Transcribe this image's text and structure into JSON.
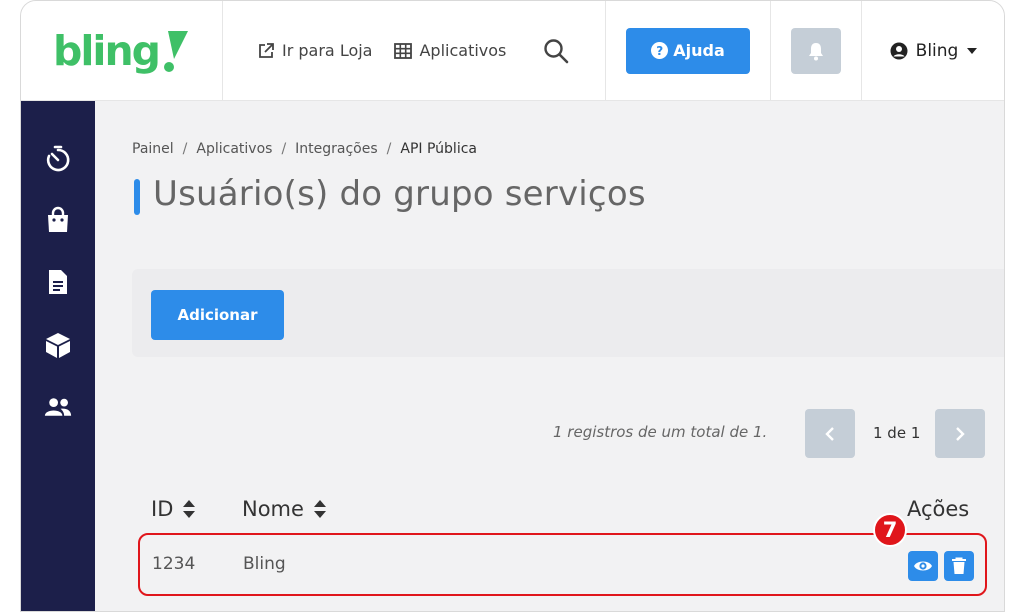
{
  "brand": {
    "name": "bling",
    "color": "#3fc067"
  },
  "header": {
    "store_link": "Ir para Loja",
    "apps_link": "Aplicativos",
    "help_label": "Ajuda",
    "help_glyph": "?",
    "user_label": "Bling"
  },
  "sidebar": {
    "items": [
      {
        "icon": "stopwatch-icon"
      },
      {
        "icon": "shopping-bag-icon"
      },
      {
        "icon": "document-icon"
      },
      {
        "icon": "box-icon"
      },
      {
        "icon": "users-icon"
      }
    ]
  },
  "breadcrumb": {
    "items": [
      "Painel",
      "Aplicativos",
      "Integrações",
      "API Pública"
    ],
    "separator": "/"
  },
  "page": {
    "title": "Usuário(s) do grupo serviços"
  },
  "toolbar": {
    "add_label": "Adicionar"
  },
  "pagination": {
    "summary": "1 registros de um total de 1.",
    "page_info": "1 de 1"
  },
  "table": {
    "columns": [
      "ID",
      "Nome",
      "Ações"
    ],
    "rows": [
      {
        "id": "1234",
        "name": "Bling"
      }
    ]
  },
  "annotation": {
    "step": "7"
  },
  "colors": {
    "primary": "#2d8ce9",
    "sidebar": "#1c1f4a",
    "highlight": "#e0161b",
    "disabled": "#c5ced7"
  }
}
